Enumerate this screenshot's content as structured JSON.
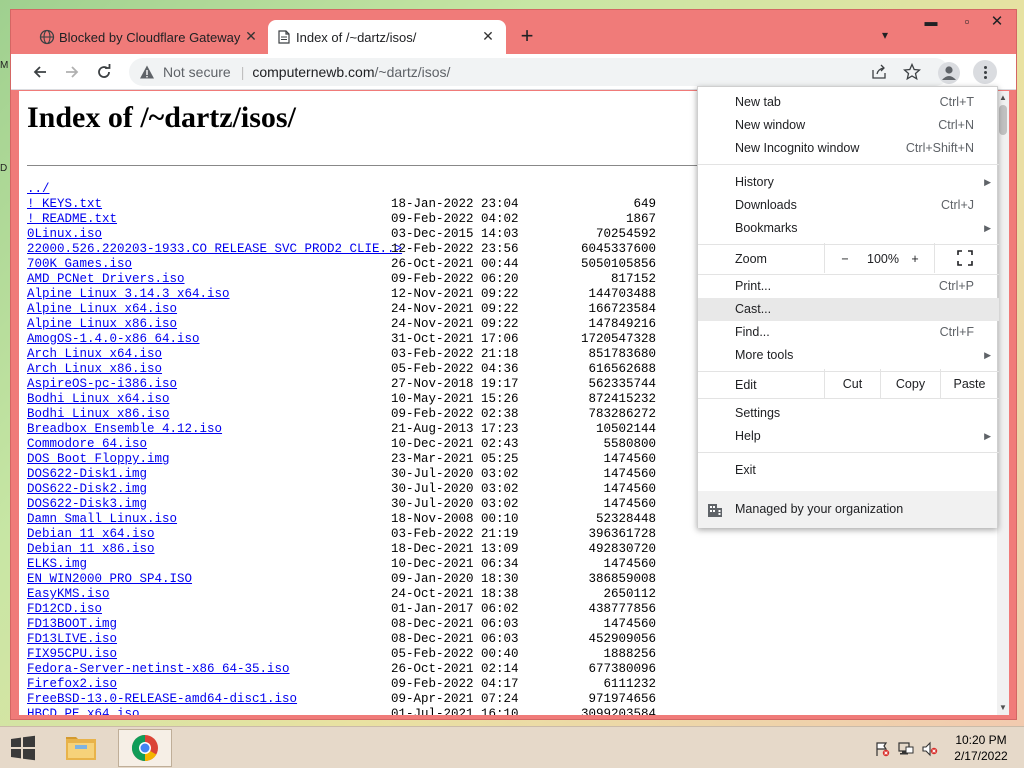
{
  "desktop": {
    "peek_left_top": "M",
    "peek_left_mid": "D"
  },
  "tabs": [
    {
      "title": "Blocked by Cloudflare Gateway",
      "icon": "globe-icon",
      "active": false
    },
    {
      "title": "Index of /~dartz/isos/",
      "icon": "page-icon",
      "active": true
    }
  ],
  "toolbar": {
    "not_secure_label": "Not secure",
    "url_host": "computernewb.com",
    "url_path": "/~dartz/isos/"
  },
  "page": {
    "title": "Index of /~dartz/isos/",
    "parent_link": "../",
    "rows": [
      {
        "name": "!_KEYS.txt",
        "date": "18-Jan-2022 23:04",
        "size": "649"
      },
      {
        "name": "!_README.txt",
        "date": "09-Feb-2022 04:02",
        "size": "1867"
      },
      {
        "name": "0Linux.iso",
        "date": "03-Dec-2015 14:03",
        "size": "70254592"
      },
      {
        "name": "22000.526.220203-1933.CO_RELEASE_SVC_PROD2_CLIE..>",
        "date": "12-Feb-2022 23:56",
        "size": "6045337600"
      },
      {
        "name": "700K_Games.iso",
        "date": "26-Oct-2021 00:44",
        "size": "5050105856"
      },
      {
        "name": "AMD_PCNet_Drivers.iso",
        "date": "09-Feb-2022 06:20",
        "size": "817152"
      },
      {
        "name": "Alpine_Linux_3.14.3_x64.iso",
        "date": "12-Nov-2021 09:22",
        "size": "144703488"
      },
      {
        "name": "Alpine_Linux_x64.iso",
        "date": "24-Nov-2021 09:22",
        "size": "166723584"
      },
      {
        "name": "Alpine_Linux_x86.iso",
        "date": "24-Nov-2021 09:22",
        "size": "147849216"
      },
      {
        "name": "AmogOS-1.4.0-x86_64.iso",
        "date": "31-Oct-2021 17:06",
        "size": "1720547328"
      },
      {
        "name": "Arch_Linux_x64.iso",
        "date": "03-Feb-2022 21:18",
        "size": "851783680"
      },
      {
        "name": "Arch_Linux_x86.iso",
        "date": "05-Feb-2022 04:36",
        "size": "616562688"
      },
      {
        "name": "AspireOS-pc-i386.iso",
        "date": "27-Nov-2018 19:17",
        "size": "562335744"
      },
      {
        "name": "Bodhi_Linux_x64.iso",
        "date": "10-May-2021 15:26",
        "size": "872415232"
      },
      {
        "name": "Bodhi_Linux_x86.iso",
        "date": "09-Feb-2022 02:38",
        "size": "783286272"
      },
      {
        "name": "Breadbox_Ensemble_4.12.iso",
        "date": "21-Aug-2013 17:23",
        "size": "10502144"
      },
      {
        "name": "Commodore_64.iso",
        "date": "10-Dec-2021 02:43",
        "size": "5580800"
      },
      {
        "name": "DOS_Boot_Floppy.img",
        "date": "23-Mar-2021 05:25",
        "size": "1474560"
      },
      {
        "name": "DOS622-Disk1.img",
        "date": "30-Jul-2020 03:02",
        "size": "1474560"
      },
      {
        "name": "DOS622-Disk2.img",
        "date": "30-Jul-2020 03:02",
        "size": "1474560"
      },
      {
        "name": "DOS622-Disk3.img",
        "date": "30-Jul-2020 03:02",
        "size": "1474560"
      },
      {
        "name": "Damn_Small_Linux.iso",
        "date": "18-Nov-2008 00:10",
        "size": "52328448"
      },
      {
        "name": "Debian_11_x64.iso",
        "date": "03-Feb-2022 21:19",
        "size": "396361728"
      },
      {
        "name": "Debian_11_x86.iso",
        "date": "18-Dec-2021 13:09",
        "size": "492830720"
      },
      {
        "name": "ELKS.img",
        "date": "10-Dec-2021 06:34",
        "size": "1474560"
      },
      {
        "name": "EN_WIN2000_PRO_SP4.ISO",
        "date": "09-Jan-2020 18:30",
        "size": "386859008"
      },
      {
        "name": "EasyKMS.iso",
        "date": "24-Oct-2021 18:38",
        "size": "2650112"
      },
      {
        "name": "FD12CD.iso",
        "date": "01-Jan-2017 06:02",
        "size": "438777856"
      },
      {
        "name": "FD13BOOT.img",
        "date": "08-Dec-2021 06:03",
        "size": "1474560"
      },
      {
        "name": "FD13LIVE.iso",
        "date": "08-Dec-2021 06:03",
        "size": "452909056"
      },
      {
        "name": "FIX95CPU.iso",
        "date": "05-Feb-2022 00:40",
        "size": "1888256"
      },
      {
        "name": "Fedora-Server-netinst-x86_64-35.iso",
        "date": "26-Oct-2021 02:14",
        "size": "677380096"
      },
      {
        "name": "Firefox2.iso",
        "date": "09-Feb-2022 04:17",
        "size": "6111232"
      },
      {
        "name": "FreeBSD-13.0-RELEASE-amd64-disc1.iso",
        "date": "09-Apr-2021 07:24",
        "size": "971974656"
      },
      {
        "name": "HBCD_PE_x64.iso",
        "date": "01-Jul-2021 16:10",
        "size": "3099203584"
      }
    ]
  },
  "menu": {
    "new_tab": "New tab",
    "new_tab_sc": "Ctrl+T",
    "new_window": "New window",
    "new_window_sc": "Ctrl+N",
    "new_incognito": "New Incognito window",
    "new_incognito_sc": "Ctrl+Shift+N",
    "history": "History",
    "downloads": "Downloads",
    "downloads_sc": "Ctrl+J",
    "bookmarks": "Bookmarks",
    "zoom": "Zoom",
    "zoom_minus": "−",
    "zoom_value": "100%",
    "zoom_plus": "+",
    "print": "Print...",
    "print_sc": "Ctrl+P",
    "cast": "Cast...",
    "find": "Find...",
    "find_sc": "Ctrl+F",
    "more_tools": "More tools",
    "edit": "Edit",
    "cut": "Cut",
    "copy": "Copy",
    "paste": "Paste",
    "settings": "Settings",
    "help": "Help",
    "exit": "Exit",
    "managed": "Managed by your organization",
    "highlighted_item": "Cast..."
  },
  "taskbar": {
    "time": "10:20 PM",
    "date": "2/17/2022"
  },
  "colors": {
    "frame": "#f07b79",
    "link": "#0000ee",
    "taskbar": "#e6d9c9"
  }
}
